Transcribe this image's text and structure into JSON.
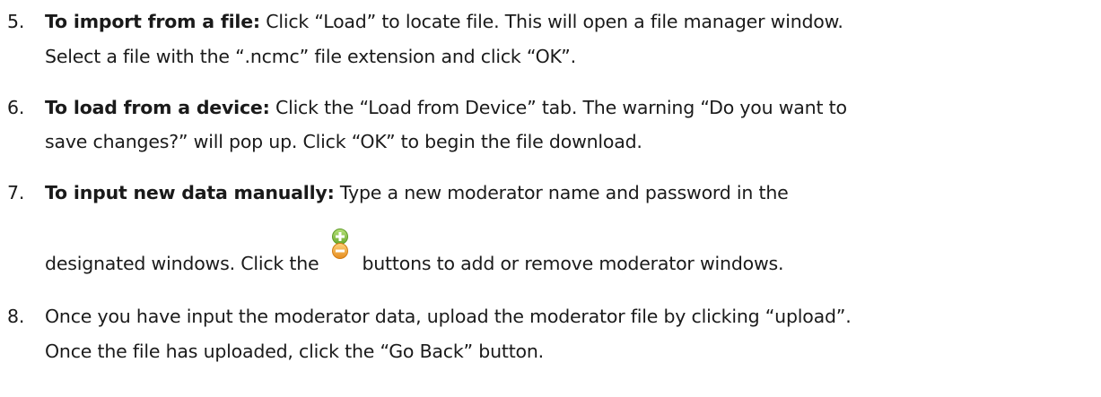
{
  "steps": [
    {
      "number": "5.",
      "bold": "To import from a file:",
      "line1": " Click “Load” to locate file. This will open a file manager window.",
      "line2": "Select a file with the “.ncmc” file extension and click “OK”."
    },
    {
      "number": "6.",
      "bold": "To load from a device:",
      "line1": " Click the “Load from Device” tab. The warning “Do you want to",
      "line2": "save changes?” will pop up. Click “OK” to begin the file download."
    },
    {
      "number": "7.",
      "bold": "To input new data manually:",
      "line1": " Type a new moderator name and password in the",
      "line2_before": "designated windows. Click the",
      "line2_after": "buttons to add or remove moderator windows.",
      "icon": "add-remove-icon"
    },
    {
      "number": "8.",
      "line1": "Once you have input the moderator data, upload the moderator file by clicking “upload”.",
      "line2": "Once the file has uploaded, click the “Go Back” button."
    }
  ],
  "colors": {
    "text": "#1a1a1a",
    "add_icon": "#8cc63f",
    "remove_icon": "#f2a93b"
  }
}
